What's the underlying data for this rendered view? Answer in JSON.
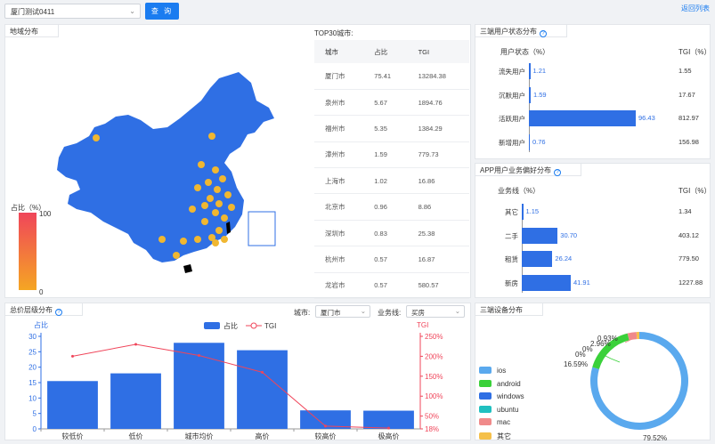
{
  "topbar": {
    "project_select": "厦门测试0411",
    "query_button": "查 询",
    "back_link": "返回列表"
  },
  "map_panel": {
    "title": "地域分布",
    "top30_title": "TOP30城市:",
    "table_headers": [
      "城市",
      "占比",
      "TGI"
    ],
    "rows": [
      [
        "厦门市",
        "75.41",
        "13284.38"
      ],
      [
        "泉州市",
        "5.67",
        "1894.76"
      ],
      [
        "福州市",
        "5.35",
        "1384.29"
      ],
      [
        "漳州市",
        "1.59",
        "779.73"
      ],
      [
        "上海市",
        "1.02",
        "16.86"
      ],
      [
        "北京市",
        "0.96",
        "8.86"
      ],
      [
        "深圳市",
        "0.83",
        "25.38"
      ],
      [
        "杭州市",
        "0.57",
        "16.87"
      ],
      [
        "龙岩市",
        "0.57",
        "580.57"
      ]
    ],
    "legend_title": "占比（%）",
    "legend_max": "100",
    "legend_min": "0",
    "colors": {
      "map_fill": "#2f6fe4",
      "dot": "#f0b731",
      "high": "#f0455a",
      "low": "#f5a623"
    }
  },
  "user_status": {
    "title": "三端用户状态分布",
    "col_label": "用户状态（%）",
    "col_tgi": "TGI（%）",
    "rows": [
      {
        "label": "流失用户",
        "value": 1.21,
        "value_text": "1.21",
        "tgi": "1.55"
      },
      {
        "label": "沉默用户",
        "value": 1.59,
        "value_text": "1.59",
        "tgi": "17.67"
      },
      {
        "label": "活跃用户",
        "value": 96.43,
        "value_text": "96.43",
        "tgi": "812.97"
      },
      {
        "label": "新增用户",
        "value": 0.76,
        "value_text": "0.76",
        "tgi": "156.98"
      }
    ]
  },
  "app_pref": {
    "title": "APP用户业务偏好分布",
    "col_label": "业务线（%）",
    "col_tgi": "TGI（%）",
    "rows": [
      {
        "label": "其它",
        "value": 1.15,
        "value_text": "1.15",
        "tgi": "1.34"
      },
      {
        "label": "二手",
        "value": 30.7,
        "value_text": "30.70",
        "tgi": "403.12"
      },
      {
        "label": "租赁",
        "value": 26.24,
        "value_text": "26.24",
        "tgi": "779.50"
      },
      {
        "label": "新房",
        "value": 41.91,
        "value_text": "41.91",
        "tgi": "1227.88"
      }
    ]
  },
  "price_panel": {
    "title": "总价层级分布",
    "city_label": "城市:",
    "city_value": "厦门市",
    "business_label": "业务线:",
    "business_value": "买房"
  },
  "device_panel": {
    "title": "三端设备分布",
    "legend": [
      {
        "name": "ios",
        "color": "#5aa9ee"
      },
      {
        "name": "android",
        "color": "#3ad13a"
      },
      {
        "name": "windows",
        "color": "#2f6fe4"
      },
      {
        "name": "ubuntu",
        "color": "#20c0c0"
      },
      {
        "name": "mac",
        "color": "#f08a8a"
      },
      {
        "name": "其它",
        "color": "#f5c04a"
      }
    ]
  },
  "chart_data": [
    {
      "type": "bar",
      "title": "",
      "legend": [
        "占比",
        "TGI"
      ],
      "legend_position": "top-center",
      "ylabel": "占比",
      "ylabel_right": "TGI",
      "categories": [
        "较低价",
        "低价",
        "城市均价",
        "高价",
        "较高价",
        "极高价"
      ],
      "series": [
        {
          "name": "占比",
          "type": "bar",
          "color": "#2f6fe4",
          "values": [
            15.5,
            18,
            27.9,
            25.5,
            6,
            5.9
          ]
        },
        {
          "name": "TGI",
          "type": "line",
          "axis": "right",
          "color": "#f0455a",
          "values": [
            200,
            230,
            202,
            160,
            25,
            20
          ]
        }
      ],
      "ylim": [
        0,
        30
      ],
      "yticks": [
        0,
        5,
        10,
        15,
        20,
        25,
        30
      ],
      "ylim_right": [
        18,
        250
      ],
      "yticks_right": [
        "18%",
        "50%",
        "100%",
        "150%",
        "200%",
        "250%"
      ],
      "yticks_right_values": [
        18,
        50,
        100,
        150,
        200,
        250
      ],
      "grid": false
    },
    {
      "type": "pie",
      "title": "",
      "labels": [
        "ios",
        "android",
        "windows",
        "ubuntu",
        "mac",
        "其它"
      ],
      "values": [
        79.52,
        16.59,
        0,
        0,
        2.96,
        0.93
      ],
      "value_labels": [
        "79.52%",
        "16.59%",
        "0%",
        "0%",
        "2.96%",
        "0.93%"
      ],
      "colors": [
        "#5aa9ee",
        "#3ad13a",
        "#2f6fe4",
        "#20c0c0",
        "#f08a8a",
        "#f5c04a"
      ],
      "donut": true
    }
  ]
}
